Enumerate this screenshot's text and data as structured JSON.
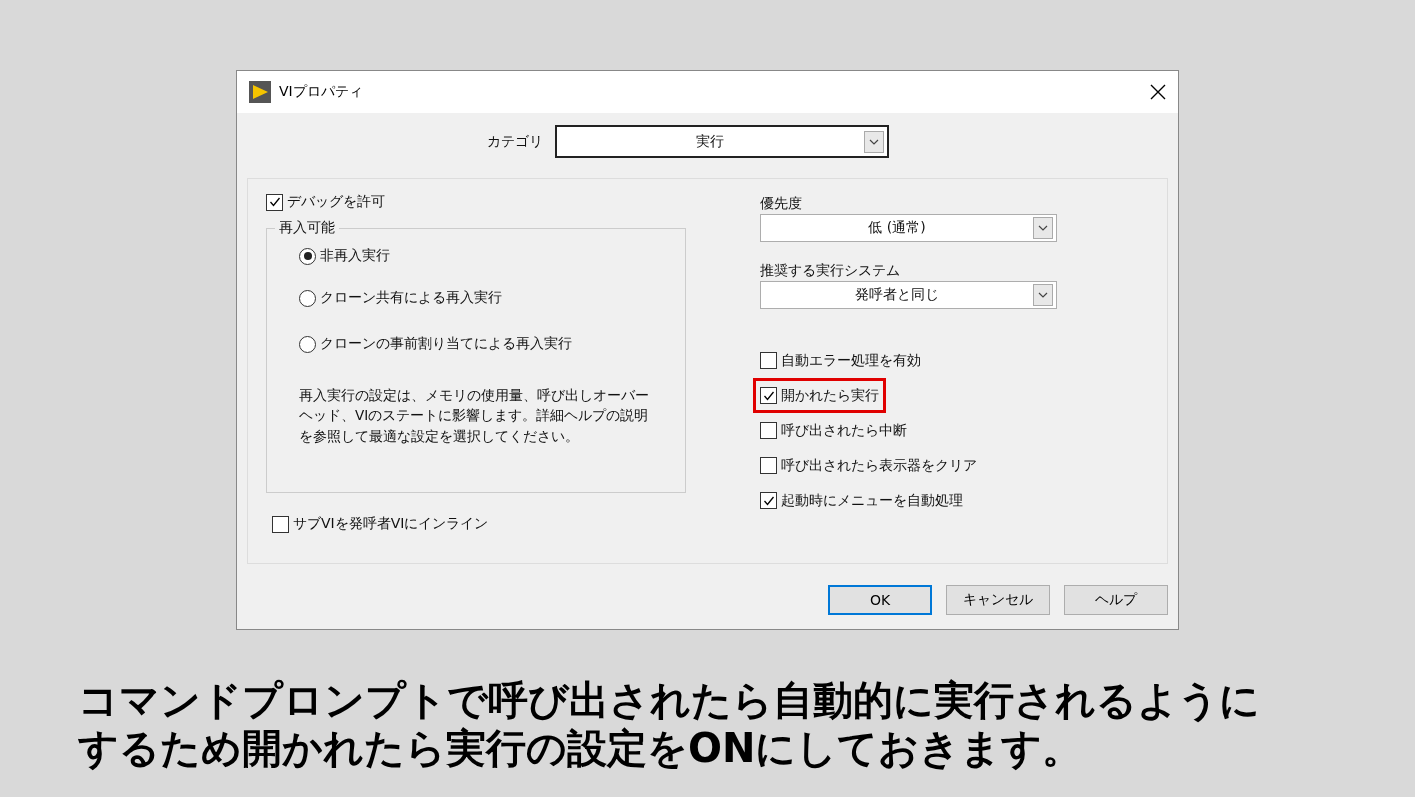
{
  "window": {
    "title": "VIプロパティ"
  },
  "category": {
    "label": "カテゴリ",
    "value": "実行"
  },
  "left": {
    "debug": {
      "label": "デバッグを許可",
      "checked": true
    },
    "reentrancy": {
      "title": "再入可能",
      "options": [
        {
          "label": "非再入実行",
          "selected": true
        },
        {
          "label": "クローン共有による再入実行",
          "selected": false
        },
        {
          "label": "クローンの事前割り当てによる再入実行",
          "selected": false
        }
      ],
      "note": "再入実行の設定は、メモリの使用量、呼び出しオーバーヘッド、VIのステートに影響します。詳細ヘルプの説明を参照して最適な設定を選択してください。"
    },
    "inline": {
      "label": "サブVIを発呼者VIにインライン",
      "checked": false
    }
  },
  "right": {
    "dropdowns": [
      {
        "label": "優先度",
        "value": "低 (通常)"
      },
      {
        "label": "推奨する実行システム",
        "value": "発呼者と同じ"
      }
    ],
    "checkboxes": [
      {
        "label": "自動エラー処理を有効",
        "checked": false,
        "highlighted": false
      },
      {
        "label": "開かれたら実行",
        "checked": true,
        "highlighted": true
      },
      {
        "label": "呼び出されたら中断",
        "checked": false,
        "highlighted": false
      },
      {
        "label": "呼び出されたら表示器をクリア",
        "checked": false,
        "highlighted": false
      },
      {
        "label": "起動時にメニューを自動処理",
        "checked": true,
        "highlighted": false
      }
    ]
  },
  "buttons": [
    {
      "label": "OK",
      "default": true
    },
    {
      "label": "キャンセル",
      "default": false
    },
    {
      "label": "ヘルプ",
      "default": false
    }
  ],
  "caption": {
    "lines": [
      "コマンドプロンプトで呼び出されたら自動的に実行されるように",
      "するため開かれたら実行の設定をONにしておきます。"
    ]
  }
}
